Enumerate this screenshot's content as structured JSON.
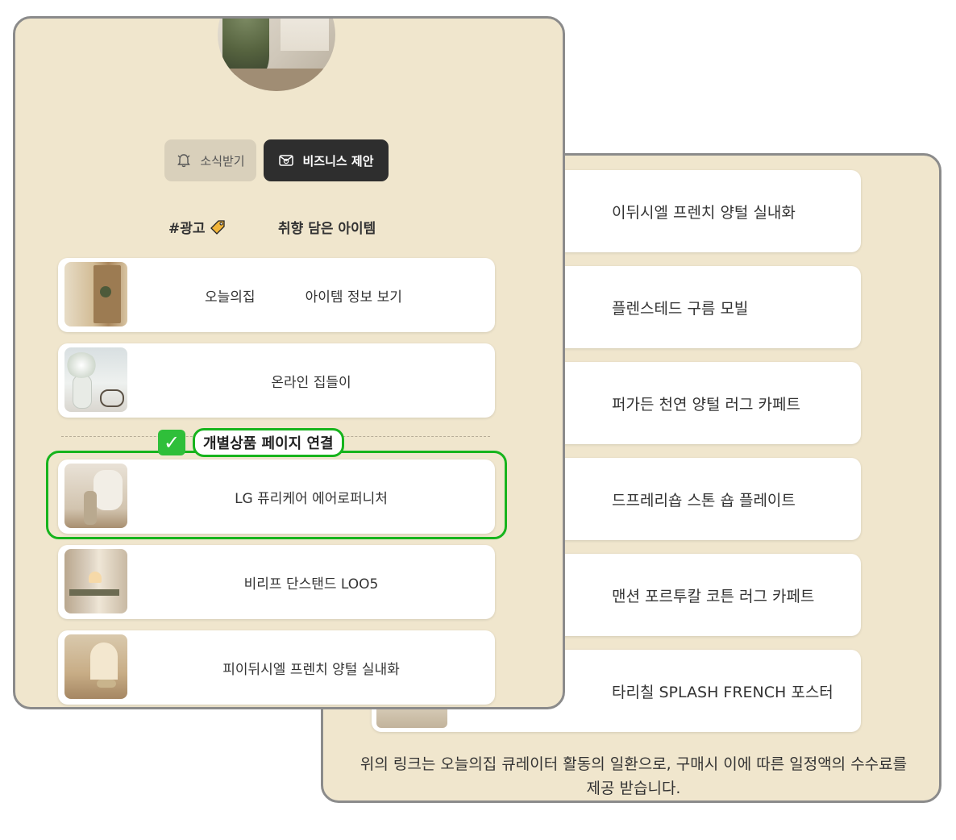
{
  "back_panel": {
    "items": [
      {
        "label": "이뒤시엘 프렌치 양털 실내화"
      },
      {
        "label": "플렌스테드 구름 모빌"
      },
      {
        "label": "퍼가든 천연 양털 러그 카페트"
      },
      {
        "label": "드프레리숍 스톤 숍 플레이트"
      },
      {
        "label": "맨션 포르투칼 코튼 러그 카페트"
      },
      {
        "label": "타리칠 SPLASH FRENCH 포스터"
      }
    ],
    "disclaimer": "위의 링크는 오늘의집 큐레이터 활동의 일환으로, 구매시 이에 따른 일정액의 수수료를 제공 받습니다."
  },
  "front_panel": {
    "buttons": {
      "news": {
        "label": "소식받기",
        "icon": "bell-icon"
      },
      "business": {
        "label": "비즈니스 제안",
        "icon": "mail-icon"
      }
    },
    "sections": {
      "ad": {
        "label": "#광고",
        "icon": "tag-icon"
      },
      "items": {
        "label": "취향 담은 아이템"
      }
    },
    "ad_items": [
      {
        "brand": "오늘의집",
        "label": "아이템 정보 보기"
      },
      {
        "label": "온라인 집들이"
      }
    ],
    "product_items": [
      {
        "label": "LG 퓨리케어 에어로퍼니처"
      },
      {
        "label": "비리프 단스탠드 LOO5"
      },
      {
        "label": "피이뒤시엘 프렌치 양털 실내화"
      }
    ],
    "highlight": {
      "label": "개별상품 페이지 연결",
      "check": "✓",
      "color": "#17b41d"
    }
  }
}
